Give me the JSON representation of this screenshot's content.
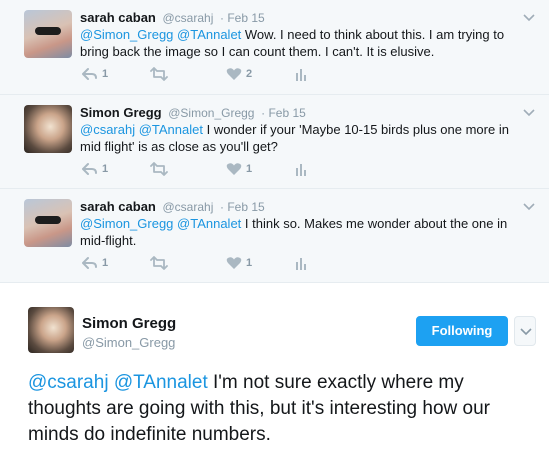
{
  "replies": [
    {
      "name": "sarah caban",
      "handle": "@csarahj",
      "time": "· Feb 15",
      "mentions": "@Simon_Gregg @TAnnalet",
      "text": " Wow. I need to think about this.  I am trying to bring back the image so I can count them. I can't. It is elusive.",
      "reply_count": "1",
      "retweet_count": "",
      "like_count": "2"
    },
    {
      "name": "Simon Gregg",
      "handle": "@Simon_Gregg",
      "time": "· Feb 15",
      "mentions": "@csarahj @TAnnalet",
      "text": " I wonder if your 'Maybe 10-15 birds plus one more in mid flight' is as close as you'll get?",
      "reply_count": "1",
      "retweet_count": "",
      "like_count": "1"
    },
    {
      "name": "sarah caban",
      "handle": "@csarahj",
      "time": "· Feb 15",
      "mentions": "@Simon_Gregg @TAnnalet",
      "text": " I think so. Makes me wonder about the one in mid-flight.",
      "reply_count": "1",
      "retweet_count": "",
      "like_count": "1"
    }
  ],
  "main": {
    "name": "Simon Gregg",
    "handle": "@Simon_Gregg",
    "follow_label": "Following",
    "mentions": "@csarahj @TAnnalet",
    "text": " I'm not sure exactly where my thoughts are going with this, but it's interesting how our minds do indefinite numbers."
  },
  "colors": {
    "accent": "#1da1f2",
    "link": "#1b95e0",
    "muted": "#8899a6",
    "reply_bg": "#f5f8fa"
  },
  "icons": [
    "chevron-down-icon",
    "reply-icon",
    "retweet-icon",
    "heart-icon",
    "analytics-icon"
  ]
}
